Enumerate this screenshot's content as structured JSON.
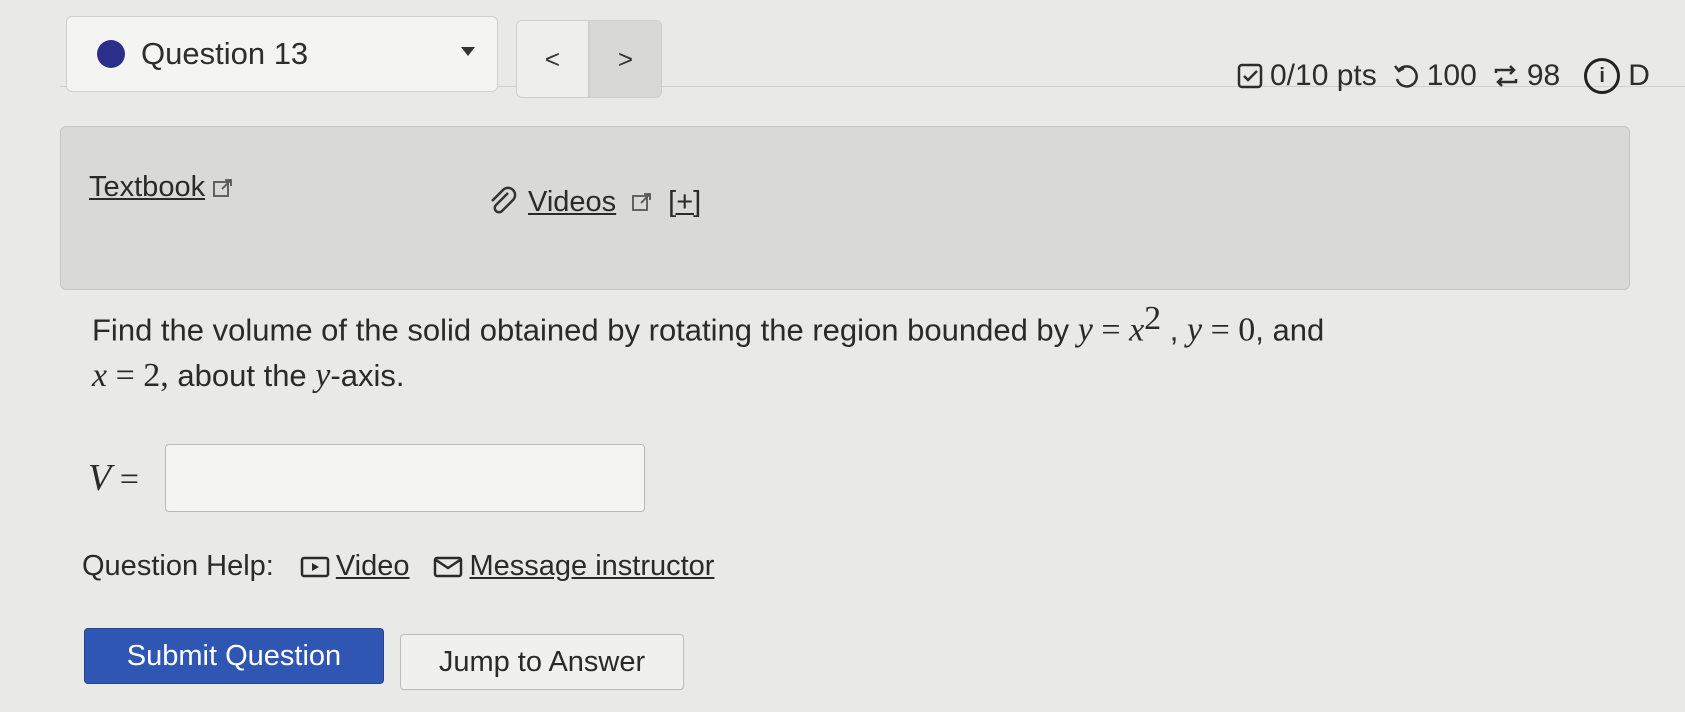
{
  "question_nav": {
    "label": "Question 13",
    "prev_label": "<",
    "next_label": ">"
  },
  "stats": {
    "points": "0/10 pts",
    "retries": "100",
    "attempts": "98",
    "info_glyph": "i",
    "truncated_text": "D"
  },
  "resources": {
    "textbook_label": "Textbook",
    "videos_label": "Videos",
    "expand_label": "[+]"
  },
  "question": {
    "text_part1": "Find the volume of the solid obtained by rotating the region bounded by ",
    "eq1_lhs": "y",
    "eq_sign": " = ",
    "eq1_rhs": "x",
    "eq1_exp": "2",
    "sep1": " , ",
    "eq2_lhs": "y",
    "eq2_rhs": "0",
    "sep2": ", and",
    "eq3_lhs": "x",
    "eq3_rhs": "2,",
    "text_part2": " about the ",
    "axis_var": "y",
    "text_part3": "-axis."
  },
  "answer": {
    "label": "V",
    "equals": " =",
    "value": "",
    "placeholder": ""
  },
  "help": {
    "label": "Question Help:",
    "video_label": "Video",
    "message_label": "Message instructor"
  },
  "actions": {
    "submit_label": "Submit Question",
    "jump_label": "Jump to Answer"
  },
  "colors": {
    "accent": "#2f56b3",
    "question_dot": "#2c2f8a"
  }
}
